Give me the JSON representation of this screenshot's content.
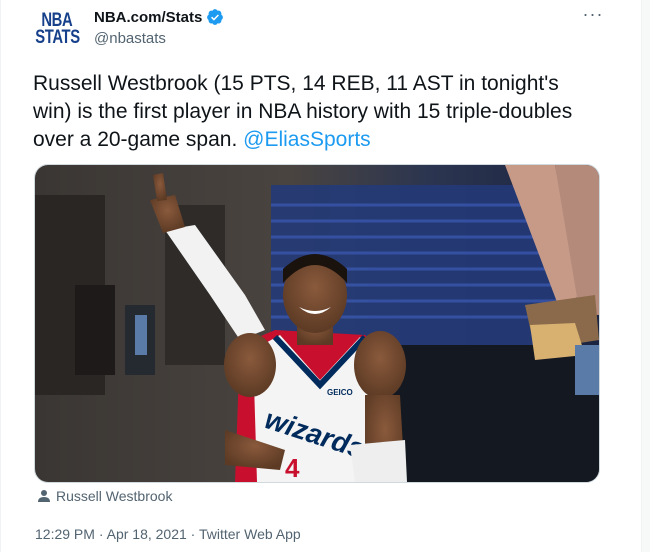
{
  "account": {
    "avatar_line1": "NBA",
    "avatar_line2": "STATS",
    "display_name": "NBA.com/Stats",
    "handle": "@nbastats",
    "verified": true
  },
  "more_label": "···",
  "tweet": {
    "text": "Russell Westbrook (15 PTS, 14 REB, 11 AST in tonight's win) is the first player in NBA history with 15 triple-doubles over a 20-game span. ",
    "mention": "@EliasSports"
  },
  "media": {
    "jersey_text": "wizards",
    "jersey_number": "4",
    "jersey_sponsor": "GEICO"
  },
  "tagged_person": "Russell Westbrook",
  "meta": {
    "time": "12:29 PM",
    "date": "Apr 18, 2021",
    "source": "Twitter Web App",
    "separator": " · "
  },
  "colors": {
    "accent": "#1d9bf0",
    "text": "#0f1419",
    "secondary": "#536471",
    "nba_blue": "#17408b"
  }
}
